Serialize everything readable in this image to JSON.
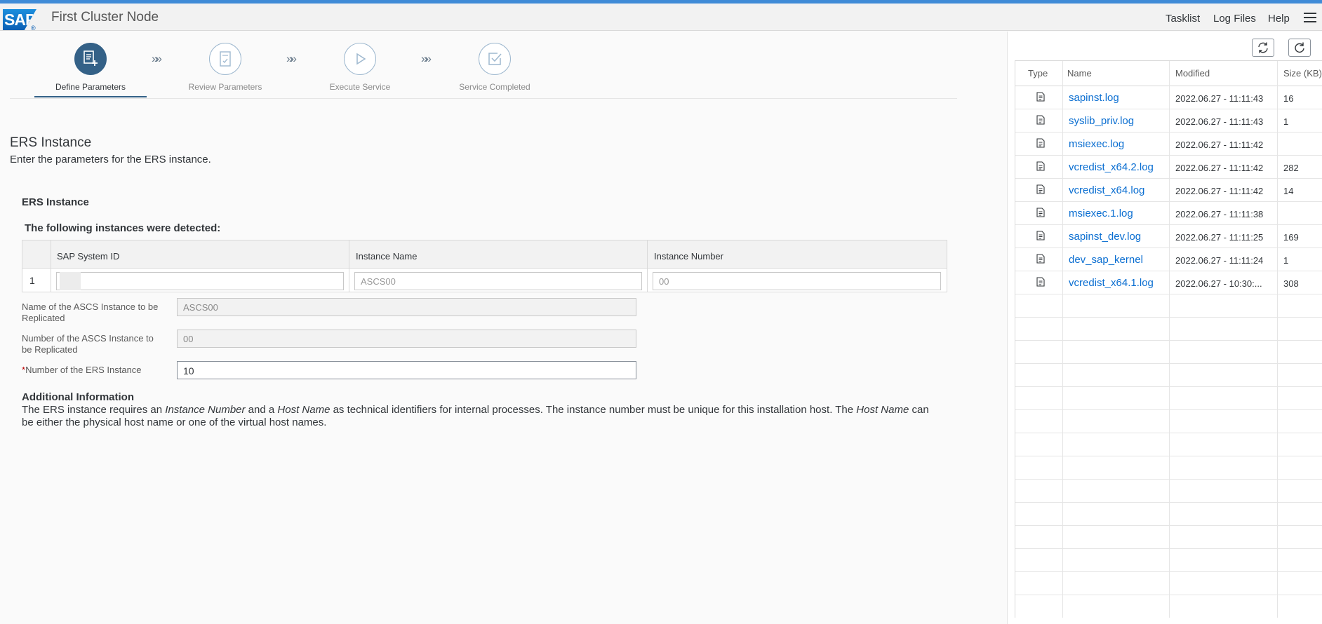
{
  "shell": {
    "logo_text": "SAP",
    "title": "First Cluster Node",
    "links": [
      "Tasklist",
      "Log Files",
      "Help"
    ]
  },
  "wizard": {
    "steps": [
      {
        "label": "Define Parameters",
        "active": true
      },
      {
        "label": "Review Parameters",
        "active": false
      },
      {
        "label": "Execute Service",
        "active": false
      },
      {
        "label": "Service Completed",
        "active": false
      }
    ],
    "separator": "»»"
  },
  "section": {
    "title": "ERS Instance",
    "description": "Enter the parameters for the ERS instance.",
    "subtitle": "ERS Instance",
    "detected_label": "The following instances were detected:"
  },
  "instances_table": {
    "columns": [
      "SAP System ID",
      "Instance Name",
      "Instance Number"
    ],
    "rows": [
      {
        "num": "1",
        "sap_system_id": "",
        "instance_name": "ASCS00",
        "instance_number": "00"
      }
    ]
  },
  "form": {
    "ascs_name_label": "Name of the ASCS Instance to be Replicated",
    "ascs_name_value": "ASCS00",
    "ascs_number_label": "Number of the ASCS Instance to be Replicated",
    "ascs_number_value": "00",
    "ers_number_required": "*",
    "ers_number_label": "Number of the ERS Instance",
    "ers_number_value": "10"
  },
  "additional": {
    "title": "Additional Information",
    "p1": "The ERS instance requires an ",
    "em1": "Instance Number",
    "p2": " and a ",
    "em2": "Host Name",
    "p3": " as technical identifiers for internal processes. The instance number must be unique for this installation host. The ",
    "em3": "Host Name",
    "p4": " can be either the physical host name or one of the virtual host names."
  },
  "log_panel": {
    "columns": [
      "Type",
      "Name",
      "Modified",
      "Size (KB)"
    ],
    "files": [
      {
        "name": "sapinst.log",
        "modified": "2022.06.27 - 11:11:43",
        "size": "16"
      },
      {
        "name": "syslib_priv.log",
        "modified": "2022.06.27 - 11:11:43",
        "size": "1"
      },
      {
        "name": "msiexec.log",
        "modified": "2022.06.27 - 11:11:42",
        "size": ""
      },
      {
        "name": "vcredist_x64.2.log",
        "modified": "2022.06.27 - 11:11:42",
        "size": "282"
      },
      {
        "name": "vcredist_x64.log",
        "modified": "2022.06.27 - 11:11:42",
        "size": "14"
      },
      {
        "name": "msiexec.1.log",
        "modified": "2022.06.27 - 11:11:38",
        "size": ""
      },
      {
        "name": "sapinst_dev.log",
        "modified": "2022.06.27 - 11:11:25",
        "size": "169"
      },
      {
        "name": "dev_sap_kernel",
        "modified": "2022.06.27 - 11:11:24",
        "size": "1"
      },
      {
        "name": "vcredist_x64.1.log",
        "modified": "2022.06.27 - 10:30:...",
        "size": "308"
      }
    ]
  },
  "colors": {
    "accent": "#346187",
    "link": "#0a6ed1",
    "required": "#bb0000"
  }
}
